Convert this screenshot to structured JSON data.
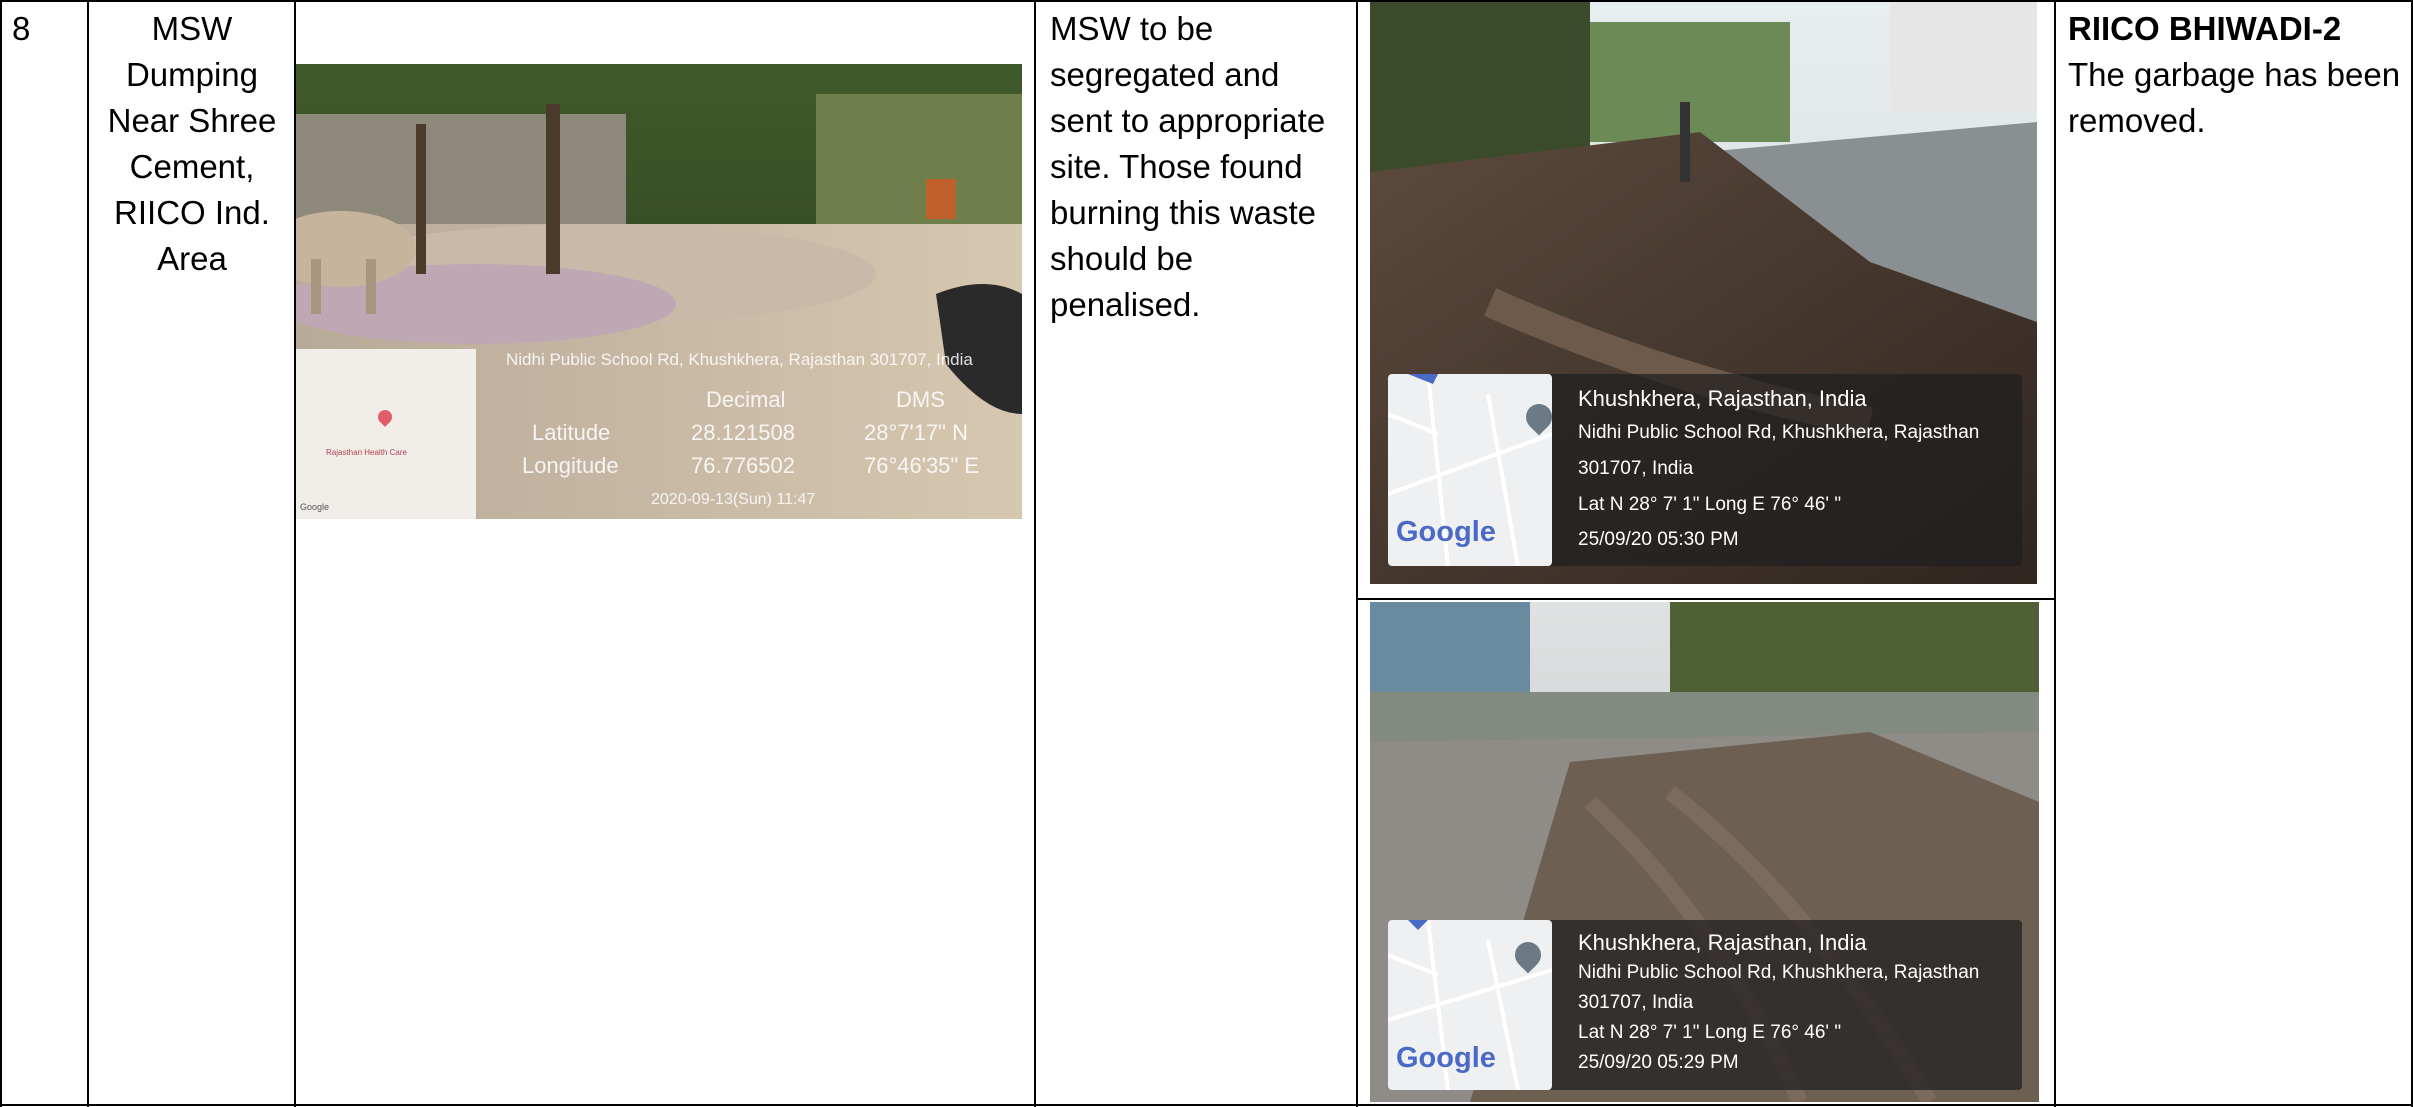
{
  "row": {
    "serial": "8",
    "location": "MSW Dumping Near Shree Cement, RIICO Ind. Area",
    "action": "MSW to be segregated and sent to appropriate site. Those found burning this waste should be penalised.",
    "status_heading": "RIICO BHIWADI-2",
    "status_text": "The garbage has been removed."
  },
  "before_photo": {
    "address": "Nidhi Public School Rd, Khushkhera, Rajasthan 301707, India",
    "col_decimal": "Decimal",
    "col_dms": "DMS",
    "lat_label": "Latitude",
    "lat_decimal": "28.121508",
    "lat_dms": "28°7'17\" N",
    "lon_label": "Longitude",
    "lon_decimal": "76.776502",
    "lon_dms": "76°46'35\" E",
    "timestamp": "2020-09-13(Sun) 11:47",
    "map_label": "Rajasthan Health Care",
    "map_brand": "Google"
  },
  "after_photos": [
    {
      "place": "Khushkhera, Rajasthan, India",
      "address_line1": "Nidhi Public School Rd, Khushkhera, Rajasthan",
      "address_line2": "301707, India",
      "coords": "Lat N 28° 7' 1\" Long E 76° 46' \"",
      "timestamp": "25/09/20 05:30 PM",
      "map_brand": "Google"
    },
    {
      "place": "Khushkhera, Rajasthan, India",
      "address_line1": "Nidhi Public School Rd, Khushkhera, Rajasthan",
      "address_line2": "301707, India",
      "coords": "Lat N 28° 7' 1\" Long E 76° 46' \"",
      "timestamp": "25/09/20 05:29 PM",
      "map_brand": "Google"
    }
  ],
  "colors": {
    "border": "#000000",
    "overlay": "#1e1e1e",
    "pin": "#6b7a84",
    "google_blue": "#4a6ac5"
  },
  "icons": [
    "map-pin-icon",
    "google-logo"
  ]
}
